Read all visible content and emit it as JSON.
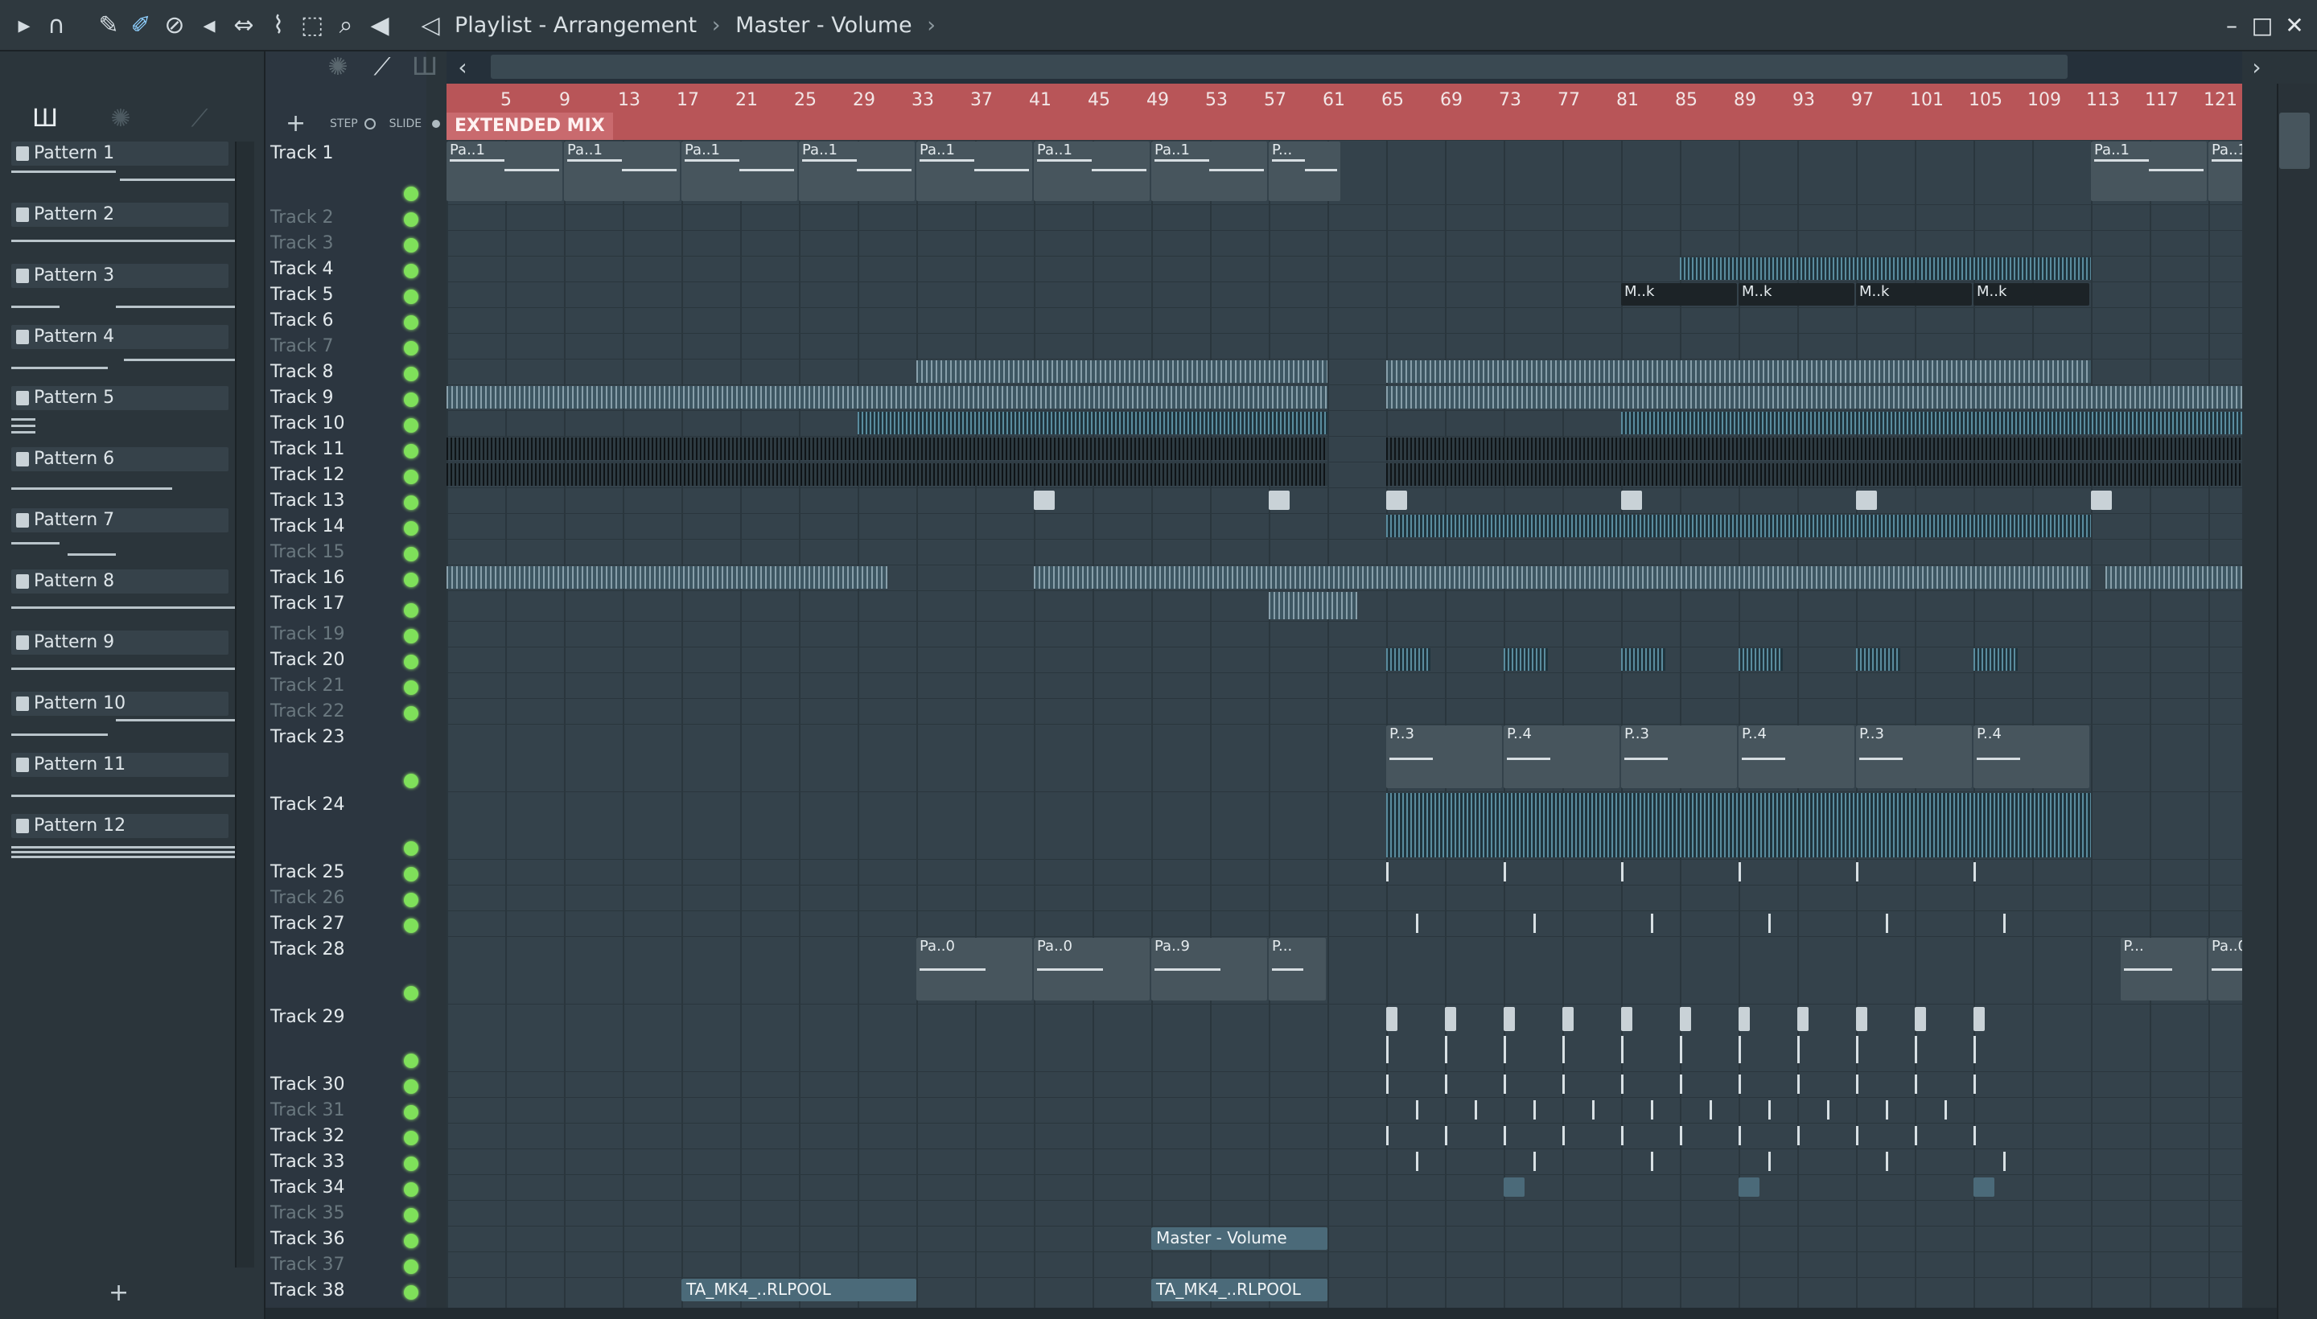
{
  "window": {
    "title_parts": [
      "Playlist - Arrangement",
      "Master - Volume"
    ],
    "separator": "›",
    "min": "–",
    "max": "□",
    "close": "✕"
  },
  "toolbar": {
    "icons": [
      "play-arrow-icon",
      "magnet-icon",
      "pencil-icon",
      "paint-icon",
      "delete-icon",
      "mute-icon",
      "slip-icon",
      "slice-icon",
      "select-icon",
      "zoom-icon",
      "speaker-icon",
      "volume-icon"
    ]
  },
  "browser": {
    "patterns": [
      "Pattern 1",
      "Pattern 2",
      "Pattern 3",
      "Pattern 4",
      "Pattern 5",
      "Pattern 6",
      "Pattern 7",
      "Pattern 8",
      "Pattern 9",
      "Pattern 10",
      "Pattern 11",
      "Pattern 12"
    ],
    "add": "+"
  },
  "tracks_panel": {
    "step": "STEP",
    "slide": "SLIDE",
    "add": "+",
    "tracks": [
      {
        "name": "Track 1",
        "dim": false,
        "h": 80
      },
      {
        "name": "Track 2",
        "dim": true,
        "h": 32
      },
      {
        "name": "Track 3",
        "dim": true,
        "h": 32
      },
      {
        "name": "Track 4",
        "dim": false,
        "h": 32
      },
      {
        "name": "Track 5",
        "dim": false,
        "h": 32
      },
      {
        "name": "Track 6",
        "dim": false,
        "h": 32
      },
      {
        "name": "Track 7",
        "dim": true,
        "h": 32
      },
      {
        "name": "Track 8",
        "dim": false,
        "h": 32
      },
      {
        "name": "Track 9",
        "dim": false,
        "h": 32
      },
      {
        "name": "Track 10",
        "dim": false,
        "h": 32
      },
      {
        "name": "Track 11",
        "dim": false,
        "h": 32
      },
      {
        "name": "Track 12",
        "dim": false,
        "h": 32
      },
      {
        "name": "Track 13",
        "dim": false,
        "h": 32
      },
      {
        "name": "Track 14",
        "dim": false,
        "h": 32
      },
      {
        "name": "Track 15",
        "dim": true,
        "h": 32
      },
      {
        "name": "Track 16",
        "dim": false,
        "h": 32
      },
      {
        "name": "Track 17",
        "dim": false,
        "h": 38
      },
      {
        "name": "Track 19",
        "dim": true,
        "h": 32
      },
      {
        "name": "Track 20",
        "dim": false,
        "h": 32
      },
      {
        "name": "Track 21",
        "dim": true,
        "h": 32
      },
      {
        "name": "Track 22",
        "dim": true,
        "h": 32
      },
      {
        "name": "Track 23",
        "dim": false,
        "h": 84
      },
      {
        "name": "Track 24",
        "dim": false,
        "h": 84
      },
      {
        "name": "Track 25",
        "dim": false,
        "h": 32
      },
      {
        "name": "Track 26",
        "dim": true,
        "h": 32
      },
      {
        "name": "Track 27",
        "dim": false,
        "h": 32
      },
      {
        "name": "Track 28",
        "dim": false,
        "h": 84
      },
      {
        "name": "Track 29",
        "dim": false,
        "h": 84
      },
      {
        "name": "Track 30",
        "dim": false,
        "h": 32
      },
      {
        "name": "Track 31",
        "dim": true,
        "h": 32
      },
      {
        "name": "Track 32",
        "dim": false,
        "h": 32
      },
      {
        "name": "Track 33",
        "dim": false,
        "h": 32
      },
      {
        "name": "Track 34",
        "dim": false,
        "h": 32
      },
      {
        "name": "Track 35",
        "dim": true,
        "h": 32
      },
      {
        "name": "Track 36",
        "dim": false,
        "h": 32
      },
      {
        "name": "Track 37",
        "dim": true,
        "h": 32
      },
      {
        "name": "Track 38",
        "dim": false,
        "h": 32
      }
    ]
  },
  "ruler": {
    "bars": [
      "5",
      "9",
      "13",
      "17",
      "21",
      "25",
      "29",
      "33",
      "37",
      "41",
      "45",
      "49",
      "53",
      "57",
      "61",
      "65",
      "69",
      "73",
      "77",
      "81",
      "85",
      "89",
      "93",
      "97",
      "101",
      "105",
      "109",
      "113",
      "117",
      "121"
    ],
    "marker": "EXTENDED MIX"
  },
  "clips": {
    "pattern1_label": "Pa..1",
    "pattern1_short": "P...",
    "track5_label": "M..k",
    "track23_a": "P..3",
    "track23_b": "P..4",
    "track28_a": "Pa..0",
    "track28_b": "Pa..9",
    "track28_short": "P...",
    "automation": "Master - Volume",
    "audio38": "TA_MK4_..RLPOOL"
  }
}
